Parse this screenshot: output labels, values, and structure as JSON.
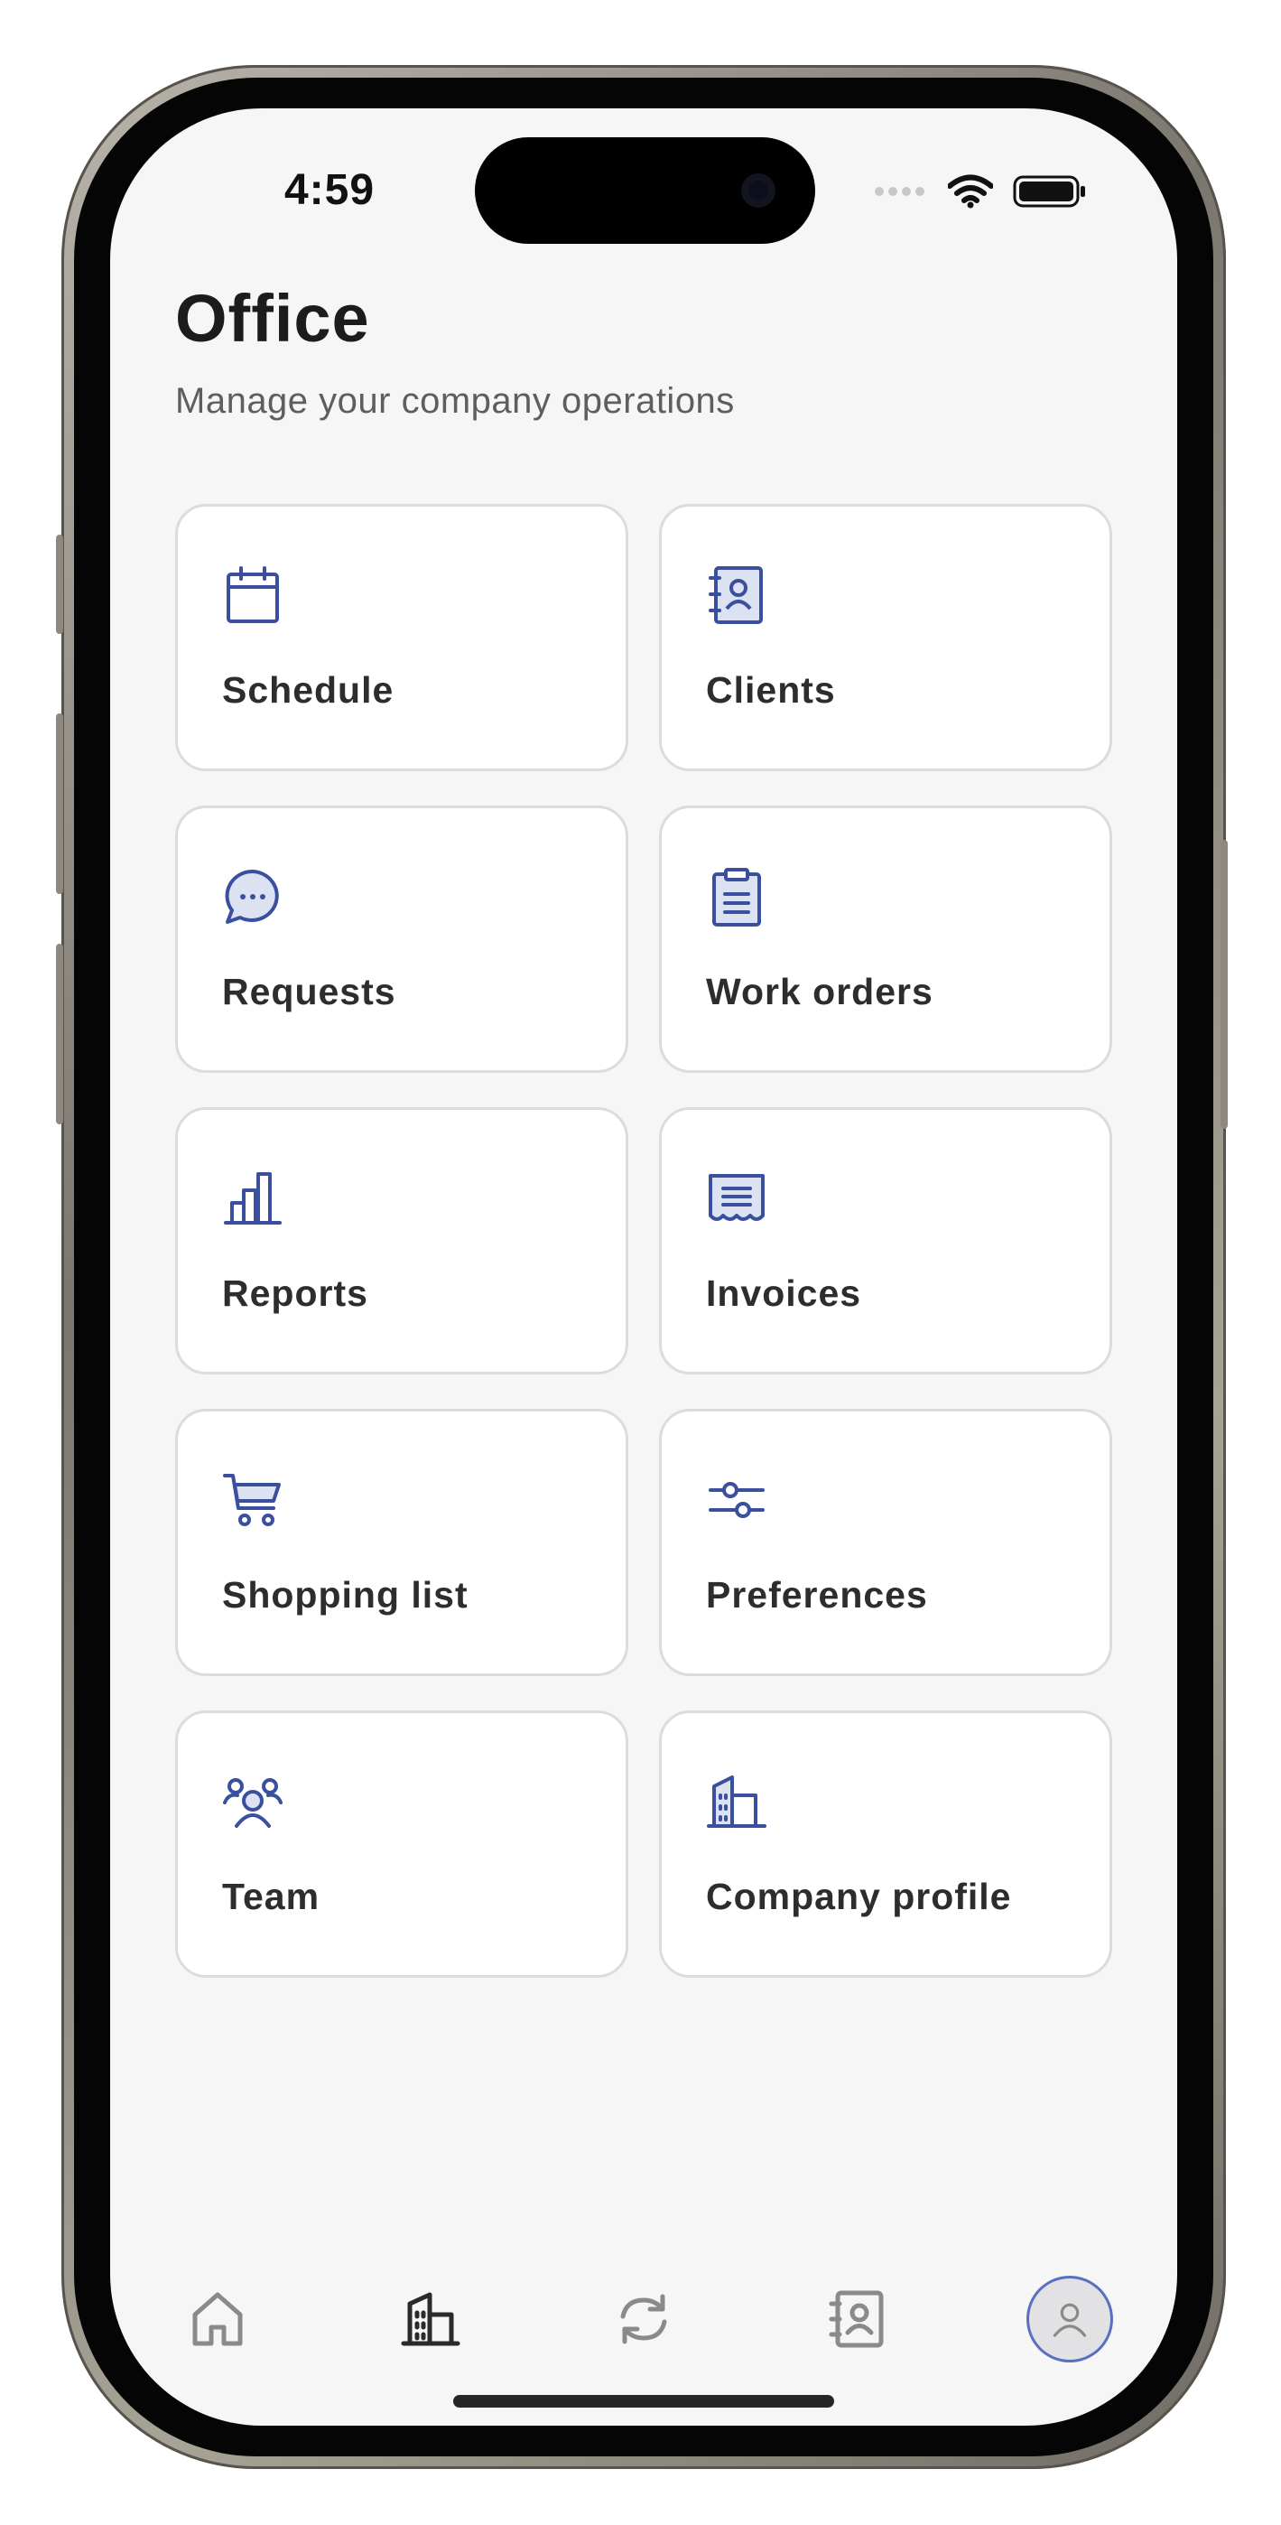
{
  "status_bar": {
    "time": "4:59"
  },
  "header": {
    "title": "Office",
    "subtitle": "Manage your company operations"
  },
  "colors": {
    "accent": "#3a4f9e",
    "icon_fill": "#dde2f3",
    "inactive_tab": "#8a8a8a",
    "active_tab": "#2a2a2a",
    "avatar_ring": "#5a6ec2"
  },
  "tiles": [
    {
      "label": "Schedule",
      "icon": "calendar-icon"
    },
    {
      "label": "Clients",
      "icon": "contact-book-icon"
    },
    {
      "label": "Requests",
      "icon": "chat-bubble-icon"
    },
    {
      "label": "Work orders",
      "icon": "clipboard-icon"
    },
    {
      "label": "Reports",
      "icon": "bar-chart-icon"
    },
    {
      "label": "Invoices",
      "icon": "receipt-icon"
    },
    {
      "label": "Shopping list",
      "icon": "shopping-cart-icon"
    },
    {
      "label": "Preferences",
      "icon": "sliders-icon"
    },
    {
      "label": "Team",
      "icon": "team-icon"
    },
    {
      "label": "Company profile",
      "icon": "building-icon"
    }
  ],
  "tab_bar": {
    "items": [
      {
        "icon": "home-icon",
        "active": false
      },
      {
        "icon": "office-building-icon",
        "active": true
      },
      {
        "icon": "refresh-icon",
        "active": false
      },
      {
        "icon": "contacts-icon",
        "active": false
      },
      {
        "icon": "profile-avatar-icon",
        "active": false
      }
    ]
  }
}
